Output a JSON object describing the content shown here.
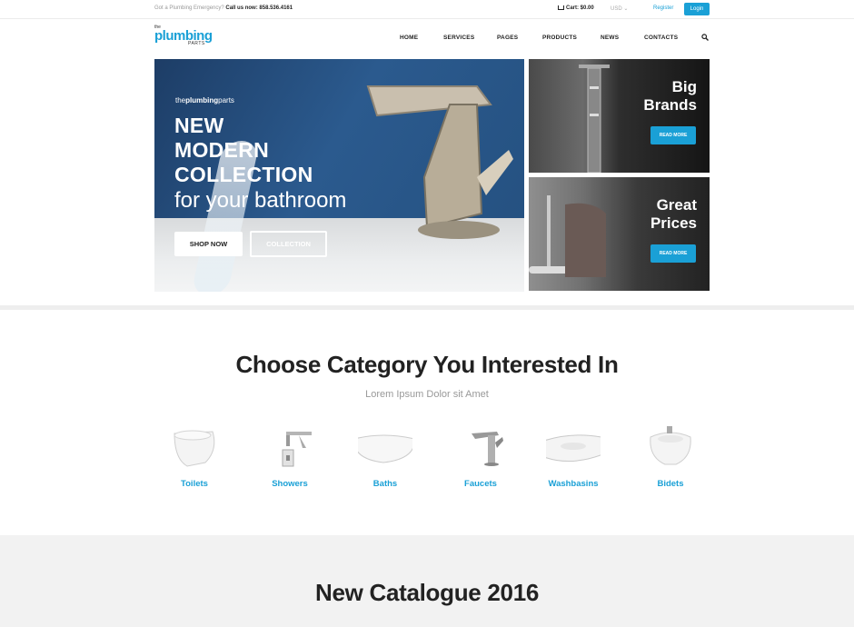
{
  "topbar": {
    "emergency_label": "Got a Plumbing Emergency?",
    "call_label": "Call us now: 858.536.4161",
    "cart_label": "Cart: $0.00",
    "currency": "USD",
    "register": "Register",
    "login": "Login"
  },
  "logo": {
    "the": "the",
    "main": "plumbing",
    "parts": "PARTS"
  },
  "nav": [
    "HOME",
    "SERVICES",
    "PAGES",
    "PRODUCTS",
    "NEWS",
    "CONTACTS"
  ],
  "hero": {
    "brand_prefix": "the",
    "brand_bold": "plumbing",
    "brand_suffix": "parts",
    "title_lines": [
      "NEW",
      "MODERN",
      "COLLECTION"
    ],
    "subtitle": "for your  bathroom",
    "shop_button": "SHOP NOW",
    "collection_button": "COLLECTION"
  },
  "promos": [
    {
      "title": "Big\nBrands",
      "button": "READ MORE"
    },
    {
      "title": "Great\nPrices",
      "button": "READ MORE"
    }
  ],
  "categories": {
    "heading": "Choose Category You Interested In",
    "subheading": "Lorem Ipsum Dolor sit Amet",
    "items": [
      {
        "label": "Toilets",
        "icon": "toilet-icon"
      },
      {
        "label": "Showers",
        "icon": "shower-icon"
      },
      {
        "label": "Baths",
        "icon": "bathtub-icon"
      },
      {
        "label": "Faucets",
        "icon": "faucet-icon"
      },
      {
        "label": "Washbasins",
        "icon": "washbasin-icon"
      },
      {
        "label": "Bidets",
        "icon": "bidet-icon"
      }
    ]
  },
  "catalogue": {
    "title": "New Catalogue 2016"
  },
  "colors": {
    "accent": "#1aa0d6",
    "text": "#222222",
    "muted": "#999999"
  }
}
